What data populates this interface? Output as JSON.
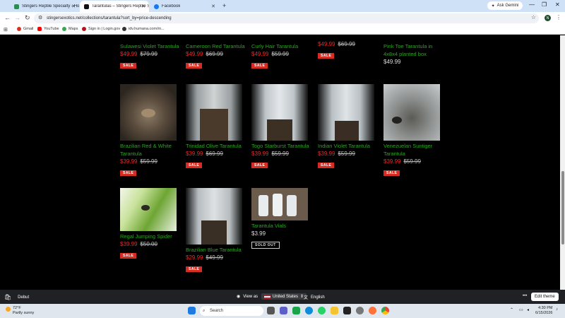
{
  "browser": {
    "tabs": [
      {
        "title": "Stingers Reptile Specialty - Ho...",
        "active": false
      },
      {
        "title": "Tarantulas – Stingers Reptile Sp...",
        "active": true
      },
      {
        "title": "Facebook",
        "active": false
      }
    ],
    "new_tab": "+",
    "ask_gemini": "Ask Gemini",
    "url": "stingersexotics.net/collections/tarantula?sort_by=price-descending",
    "profile_initial": "N"
  },
  "bookmarks": [
    {
      "label": "Gmail",
      "color": "#d93025"
    },
    {
      "label": "YouTube",
      "color": "#ff0000"
    },
    {
      "label": "Maps",
      "color": "#34a853"
    },
    {
      "label": "Sign in | Login.gov",
      "color": "#b5121b"
    },
    {
      "label": "idv.humana.com/m...",
      "color": "#333333"
    }
  ],
  "products": [
    {
      "name": "Sulawesi Violet Tarantula",
      "price": "$49.99",
      "compare": "$79.99",
      "badge": "SALE"
    },
    {
      "name": "Cameroon Red Tarantula",
      "price": "$49.99",
      "compare": "$69.99",
      "badge": "SALE"
    },
    {
      "name": "Curly Hair Tarantula",
      "price": "$49.99",
      "compare": "$59.99",
      "badge": "SALE"
    },
    {
      "name": "",
      "price": "$49.99",
      "compare": "$69.99",
      "badge": "SALE"
    },
    {
      "name": "Pink Toe Tarantula in 4x8x4 planted box",
      "price": "$49.99",
      "compare": "",
      "badge": ""
    },
    {
      "name": "Brazilian Red & White Tarantula",
      "price": "$39.99",
      "compare": "$59.99",
      "badge": "SALE"
    },
    {
      "name": "Trinidad Olive Tarantula",
      "price": "$39.99",
      "compare": "$69.99",
      "badge": "SALE"
    },
    {
      "name": "Togo Starburst Tarantula",
      "price": "$39.99",
      "compare": "$59.99",
      "badge": "SALE"
    },
    {
      "name": "Indian Violet Tarantula",
      "price": "$39.99",
      "compare": "$59.99",
      "badge": "SALE"
    },
    {
      "name": "Venezuelan Suntiger Tarantula",
      "price": "$39.99",
      "compare": "$59.99",
      "badge": "SALE"
    },
    {
      "name": "Regal Jumping Spider",
      "price": "$39.99",
      "compare": "$50.00",
      "badge": "SALE"
    },
    {
      "name": "Brazilian Blue Tarantula",
      "price": "$29.99",
      "compare": "$49.99",
      "badge": "SALE"
    },
    {
      "name": "Tarantula Vials",
      "price": "$3.99",
      "compare": "",
      "badge": "SOLD OUT"
    }
  ],
  "preview_bar": {
    "theme": "Debut",
    "view_as": "View as",
    "country": "United States",
    "language": "English",
    "edit_theme": "Edit theme"
  },
  "taskbar": {
    "weather_temp": "72°F",
    "weather_desc": "Partly sunny",
    "search_placeholder": "Search",
    "time": "4:30 PM",
    "date": "6/15/2026"
  }
}
